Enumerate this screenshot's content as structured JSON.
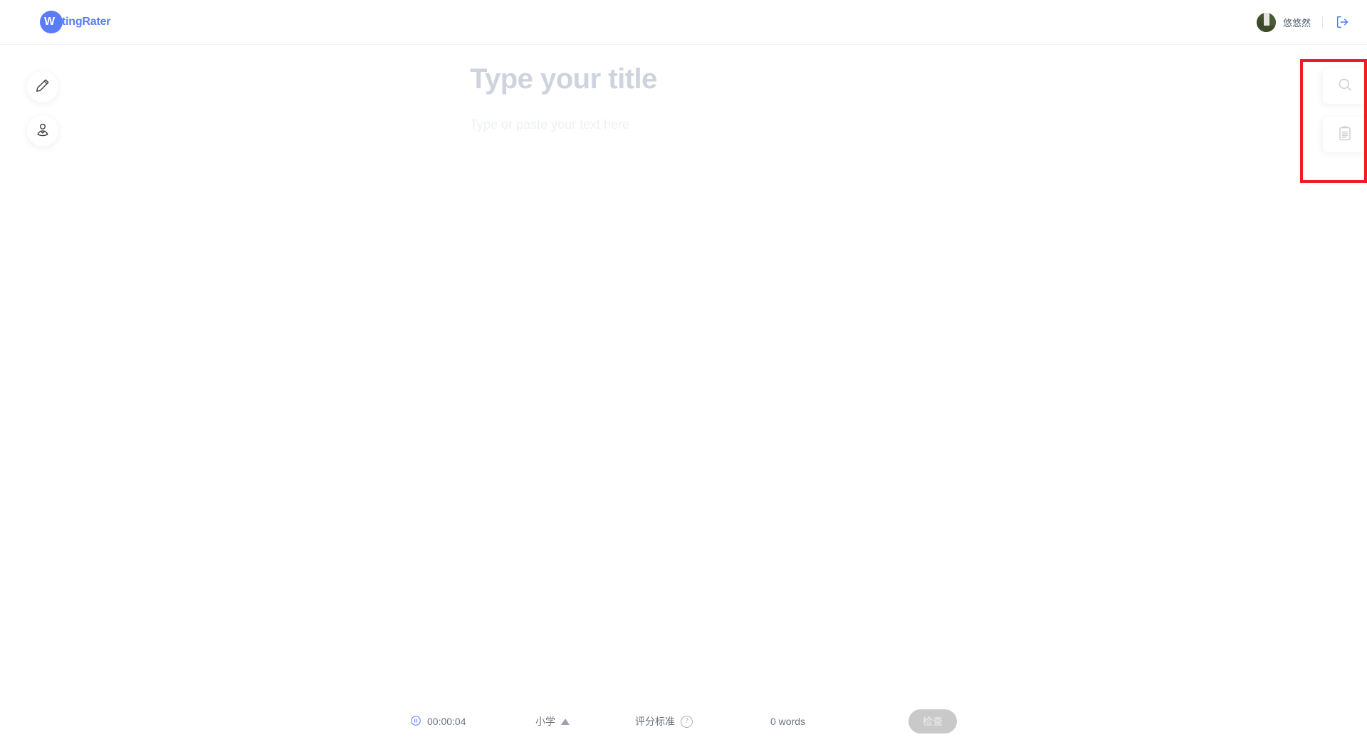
{
  "header": {
    "logo": {
      "first_letter": "W",
      "rest": "ritingRater",
      "full": "WritingRater",
      "color": "#5b7cfa"
    },
    "username": "悠悠然",
    "logout_icon": "logout-icon"
  },
  "left_rail": {
    "items": [
      {
        "icon": "pencil-icon",
        "name": "write"
      },
      {
        "icon": "user-icon",
        "name": "profile"
      }
    ]
  },
  "editor": {
    "title_value": "",
    "title_placeholder": "Type your title",
    "body_value": "",
    "body_placeholder": "Type or paste your text here"
  },
  "right_tools": {
    "items": [
      {
        "icon": "search-icon",
        "name": "search"
      },
      {
        "icon": "clipboard-icon",
        "name": "rubric-panel"
      }
    ],
    "highlight_color": "#ef1c26"
  },
  "bottom_bar": {
    "timer_icon": "pause-circle-icon",
    "timer": "00:00:04",
    "level": "小学",
    "level_caret": "▲",
    "rubric_label": "评分标准",
    "rubric_help_icon": "?",
    "word_count": "0 words",
    "check_button": "检查"
  }
}
